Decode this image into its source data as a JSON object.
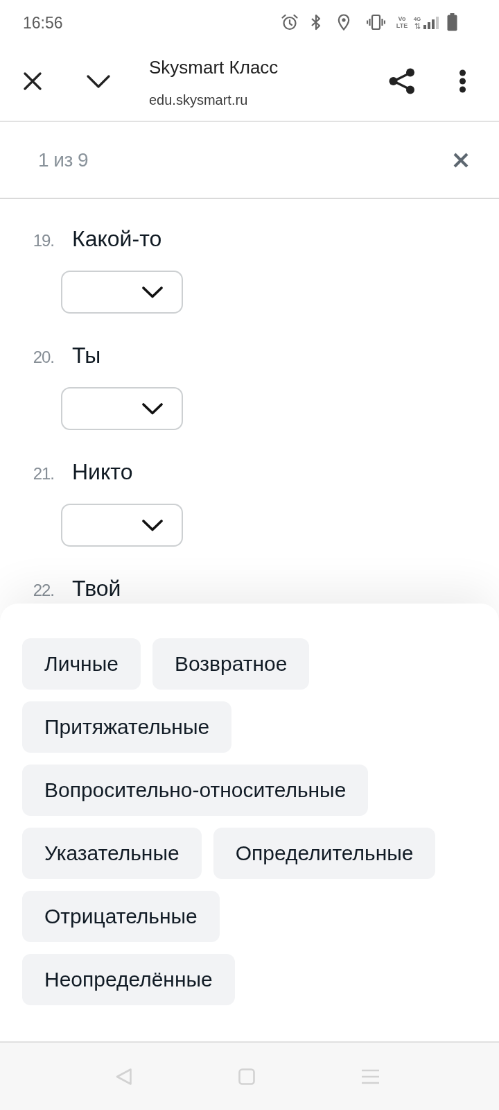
{
  "status_bar": {
    "time": "16:56",
    "volte": "Vo LTE",
    "network": "4G"
  },
  "browser_header": {
    "title": "Skysmart Класс",
    "url": "edu.skysmart.ru"
  },
  "find_bar": {
    "match_count": "1 из 9"
  },
  "questions": [
    {
      "number": "19.",
      "word": "Какой-то",
      "dropdown": true
    },
    {
      "number": "20.",
      "word": "Ты",
      "dropdown": true
    },
    {
      "number": "21.",
      "word": "Никто",
      "dropdown": true
    },
    {
      "number": "22.",
      "word": "Твой",
      "dropdown": false
    }
  ],
  "answer_option_rows": [
    [
      "Личные",
      "Возвратное"
    ],
    [
      "Притяжательные"
    ],
    [
      "Вопросительно-относительные"
    ],
    [
      "Указательные",
      "Определительные"
    ],
    [
      "Отрицательные"
    ],
    [
      "Неопределённые"
    ]
  ]
}
